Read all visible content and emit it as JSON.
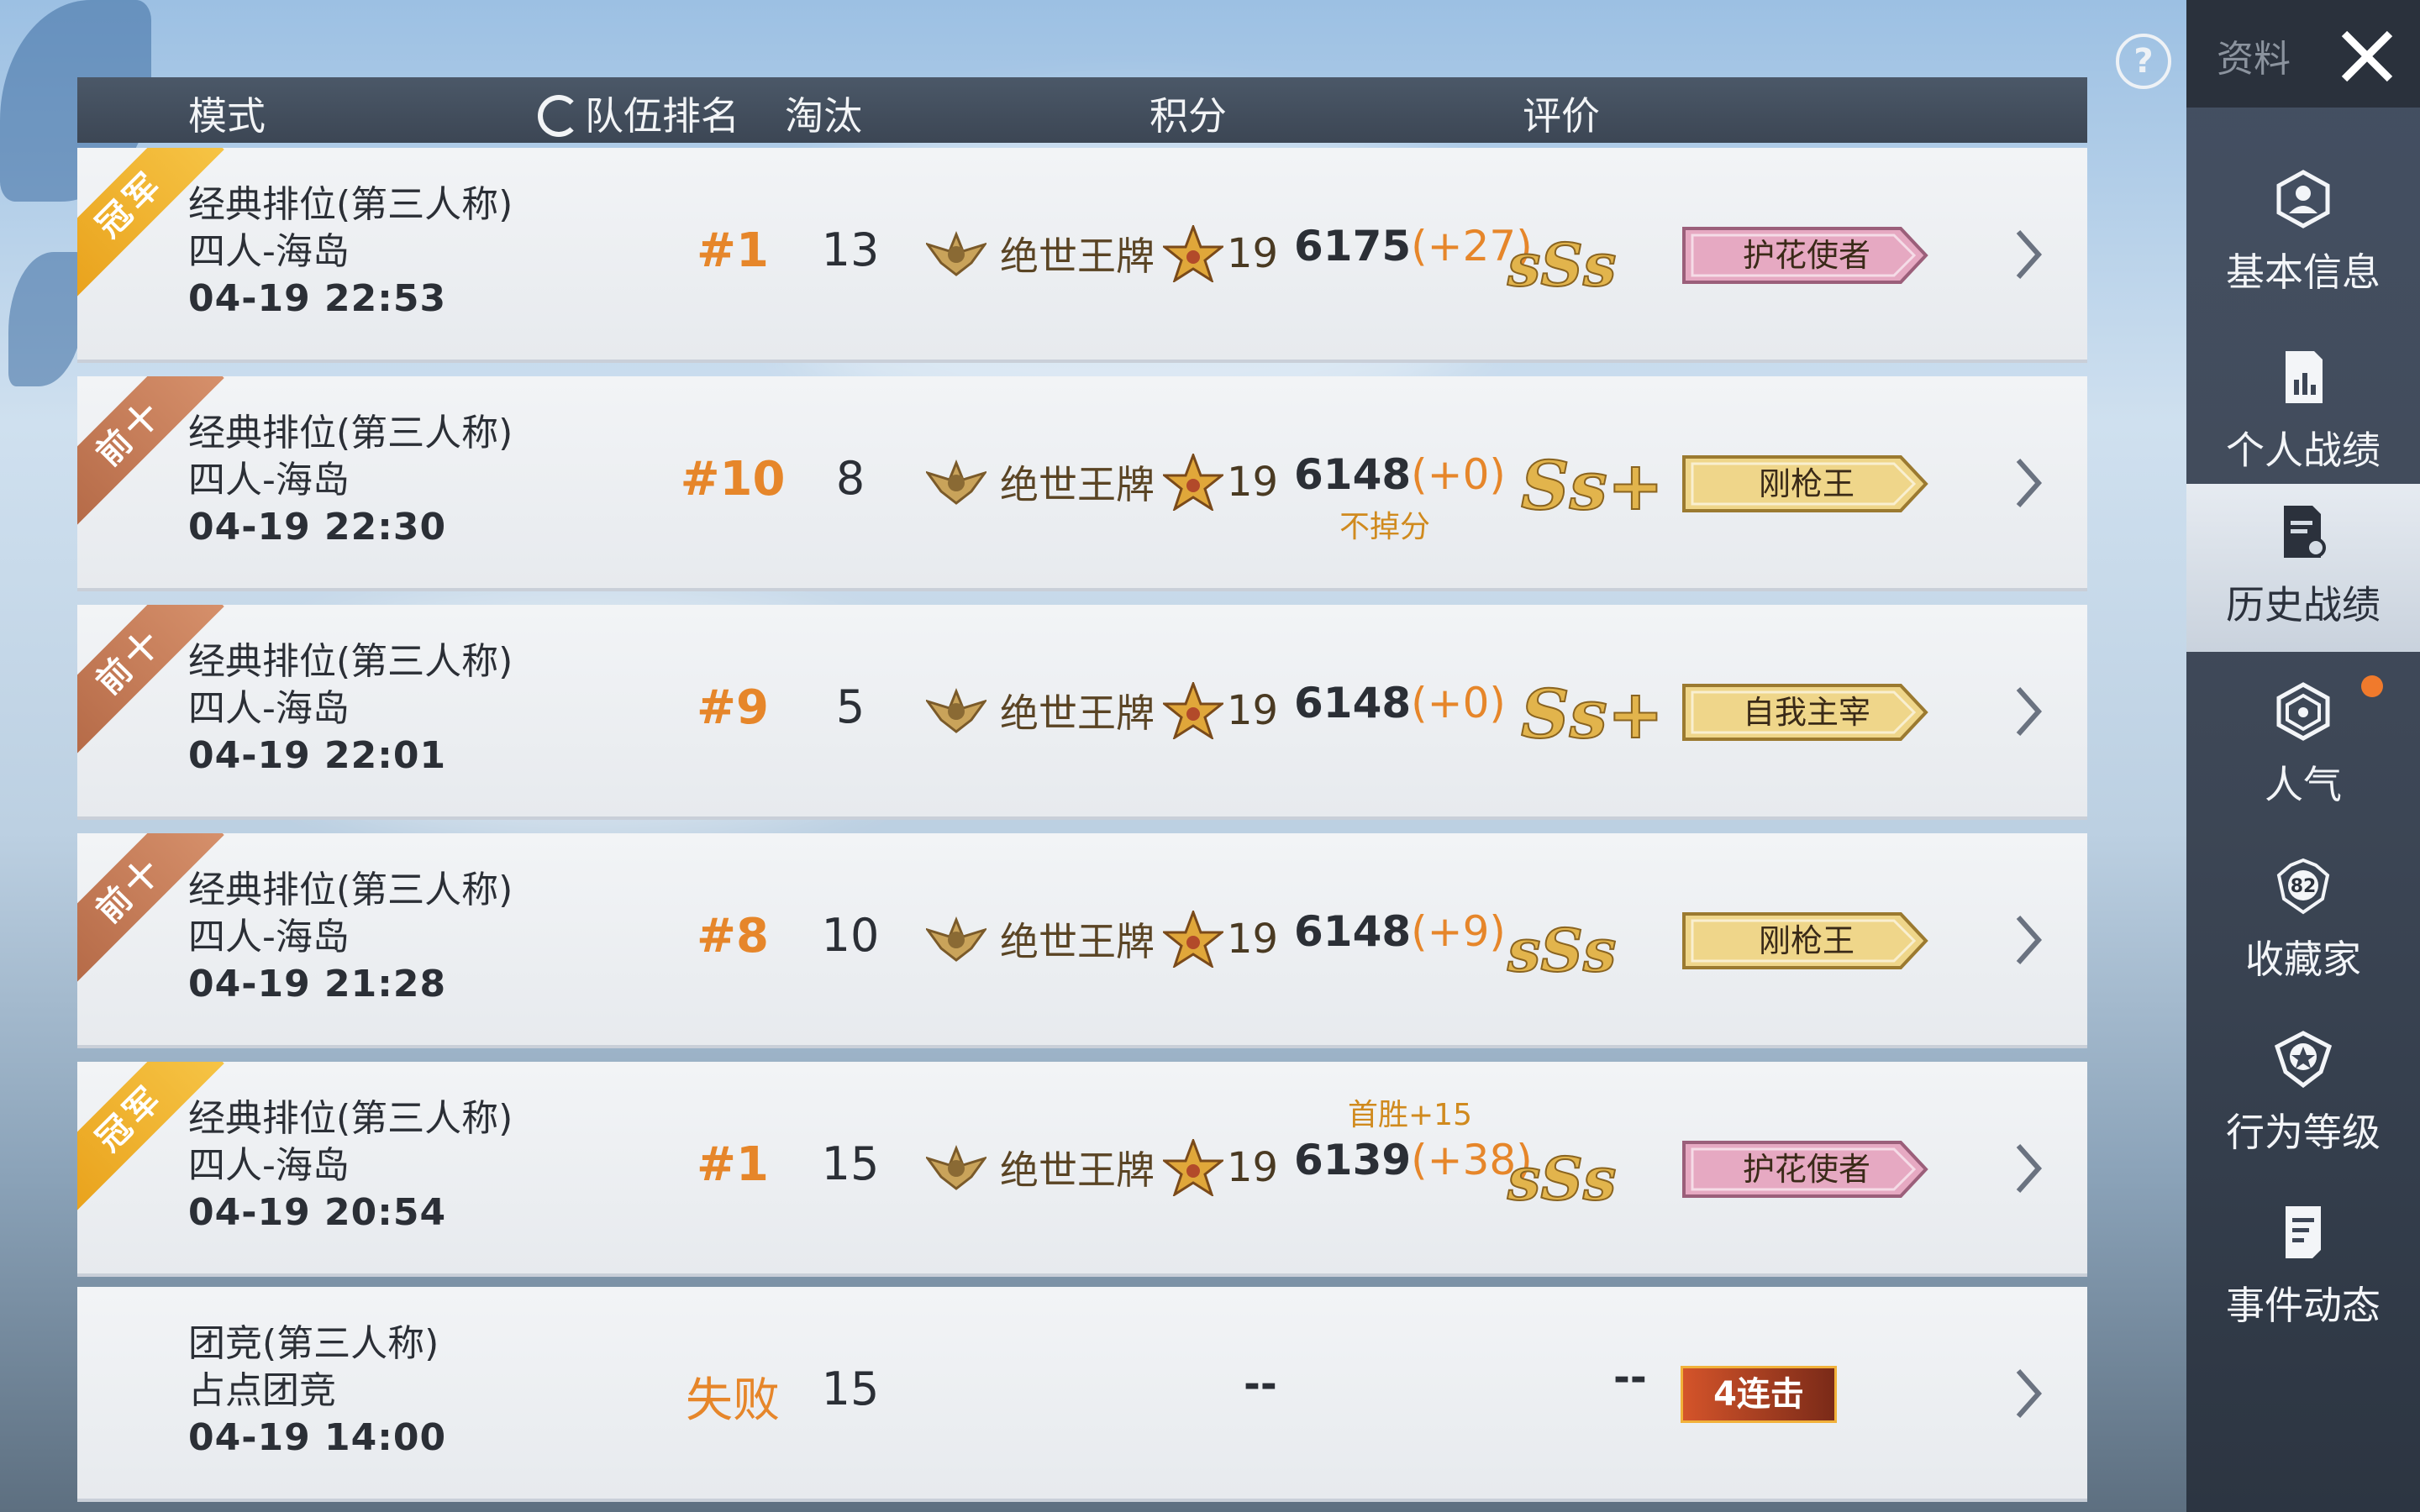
{
  "header": {
    "mode": "模式",
    "team_rank": "队伍排名",
    "eliminations": "淘汰",
    "points": "积分",
    "rating": "评价"
  },
  "rows": [
    {
      "ribbon": "冠军",
      "ribbon_style": "gold",
      "mode": "经典排位(第三人称)",
      "map": "四人-海岛",
      "time": "04-19 22:53",
      "rank": "#1",
      "elim": "13",
      "tier": "绝世王牌",
      "tier_level": "19",
      "score": "6175",
      "delta": "(+27)",
      "note": "",
      "grade": "sSs",
      "title": "护花使者",
      "title_style": "pink"
    },
    {
      "ribbon": "前十",
      "ribbon_style": "bronze",
      "mode": "经典排位(第三人称)",
      "map": "四人-海岛",
      "time": "04-19 22:30",
      "rank": "#10",
      "elim": "8",
      "tier": "绝世王牌",
      "tier_level": "19",
      "score": "6148",
      "delta": "(+0)",
      "note": "不掉分",
      "grade": "Ss+",
      "title": "刚枪王",
      "title_style": "gold"
    },
    {
      "ribbon": "前十",
      "ribbon_style": "bronze",
      "mode": "经典排位(第三人称)",
      "map": "四人-海岛",
      "time": "04-19 22:01",
      "rank": "#9",
      "elim": "5",
      "tier": "绝世王牌",
      "tier_level": "19",
      "score": "6148",
      "delta": "(+0)",
      "note": "",
      "grade": "Ss+",
      "title": "自我主宰",
      "title_style": "gold"
    },
    {
      "ribbon": "前十",
      "ribbon_style": "bronze",
      "mode": "经典排位(第三人称)",
      "map": "四人-海岛",
      "time": "04-19 21:28",
      "rank": "#8",
      "elim": "10",
      "tier": "绝世王牌",
      "tier_level": "19",
      "score": "6148",
      "delta": "(+9)",
      "note": "",
      "grade": "sSs",
      "title": "刚枪王",
      "title_style": "gold"
    },
    {
      "ribbon": "冠军",
      "ribbon_style": "gold",
      "mode": "经典排位(第三人称)",
      "map": "四人-海岛",
      "time": "04-19 20:54",
      "rank": "#1",
      "elim": "15",
      "tier": "绝世王牌",
      "tier_level": "19",
      "score": "6139",
      "delta": "(+38)",
      "note": "首胜+15",
      "grade": "sSs",
      "title": "护花使者",
      "title_style": "pink"
    }
  ],
  "last_row": {
    "mode": "团竞(第三人称)",
    "map": "占点团竞",
    "time": "04-19 14:00",
    "rank": "失败",
    "elim": "15",
    "points": "--",
    "rating": "--",
    "combo": "4连击"
  },
  "sidebar": {
    "top_label": "资料",
    "help": "?",
    "items": [
      {
        "label": "基本信息",
        "icon": "profile-icon"
      },
      {
        "label": "个人战绩",
        "icon": "stats-chart-icon"
      },
      {
        "label": "历史战绩",
        "icon": "history-doc-icon"
      },
      {
        "label": "人气",
        "icon": "popularity-icon"
      },
      {
        "label": "收藏家",
        "icon": "collector-badge-icon",
        "badge": "82"
      },
      {
        "label": "行为等级",
        "icon": "behavior-shield-icon"
      },
      {
        "label": "事件动态",
        "icon": "event-note-icon"
      }
    ]
  },
  "colors": {
    "accent": "#e6862a",
    "header": "#434f5e",
    "sidebar": "#343c4a",
    "gold_ribbon": "#f0b235",
    "bronze_ribbon": "#c77d58"
  }
}
